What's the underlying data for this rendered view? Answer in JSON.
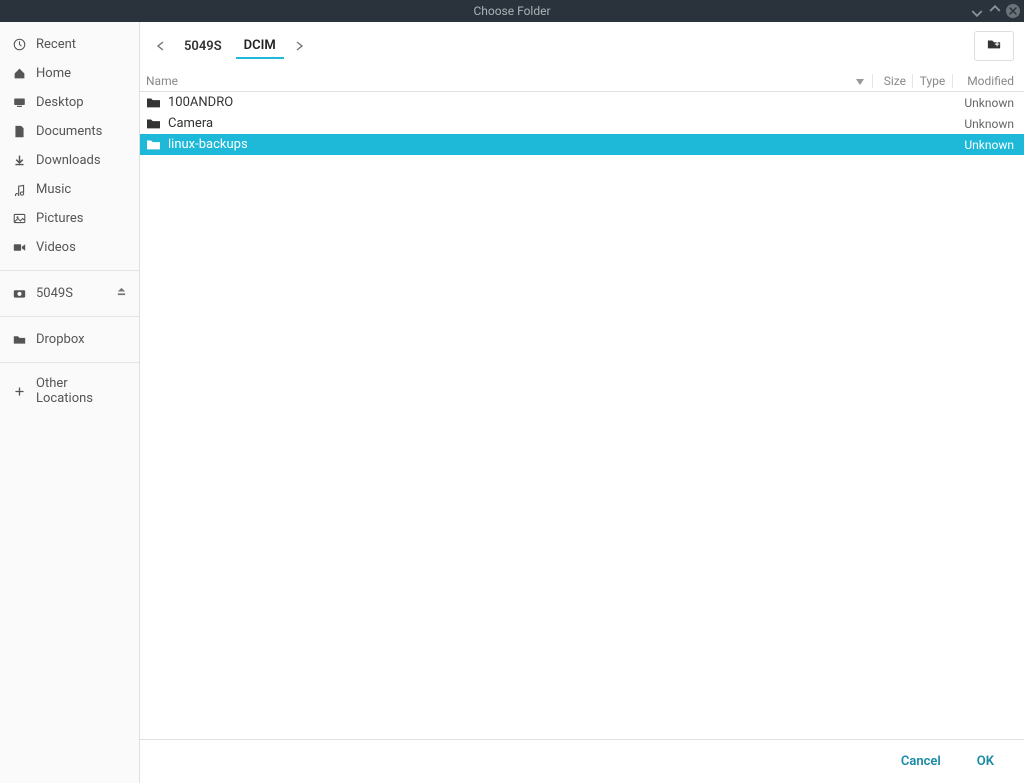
{
  "window": {
    "title": "Choose Folder"
  },
  "sidebar": {
    "places": [
      {
        "label": "Recent",
        "icon": "clock"
      },
      {
        "label": "Home",
        "icon": "home"
      },
      {
        "label": "Desktop",
        "icon": "desktop"
      },
      {
        "label": "Documents",
        "icon": "document"
      },
      {
        "label": "Downloads",
        "icon": "download"
      },
      {
        "label": "Music",
        "icon": "music"
      },
      {
        "label": "Pictures",
        "icon": "pictures"
      },
      {
        "label": "Videos",
        "icon": "video"
      }
    ],
    "devices": [
      {
        "label": "5049S",
        "icon": "camera-device",
        "ejectable": true
      }
    ],
    "bookmarks": [
      {
        "label": "Dropbox",
        "icon": "folder"
      }
    ],
    "other": {
      "label": "Other Locations",
      "icon": "plus"
    }
  },
  "breadcrumb": {
    "items": [
      {
        "label": "5049S",
        "active": false
      },
      {
        "label": "DCIM",
        "active": true
      }
    ]
  },
  "columns": {
    "name": "Name",
    "size": "Size",
    "type": "Type",
    "modified": "Modified"
  },
  "files": [
    {
      "name": "100ANDRO",
      "modified": "Unknown",
      "selected": false
    },
    {
      "name": "Camera",
      "modified": "Unknown",
      "selected": false
    },
    {
      "name": "linux-backups",
      "modified": "Unknown",
      "selected": true
    }
  ],
  "actions": {
    "cancel": "Cancel",
    "ok": "OK"
  }
}
